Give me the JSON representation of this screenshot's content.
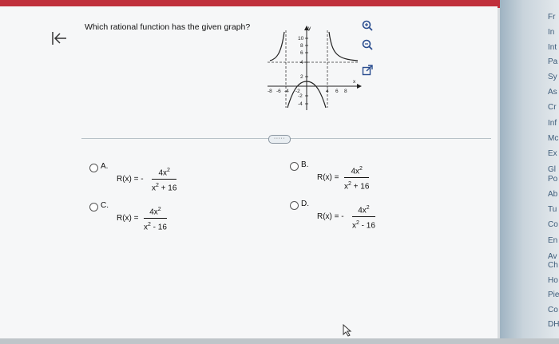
{
  "question": "Which rational function has the given graph?",
  "graph": {
    "y_axis_label": "y",
    "x_axis_label": "x",
    "y_ticks": [
      "10",
      "8",
      "6",
      "4",
      "2",
      "-2",
      "-4"
    ],
    "x_ticks_left": [
      "-8",
      "-6",
      "-4",
      "-2"
    ],
    "x_ticks_right": [
      "4",
      "6",
      "8"
    ]
  },
  "more_label": "·····",
  "options": [
    {
      "letter": "A.",
      "lhs": "R(x) = -",
      "num": "4x",
      "num_exp": "2",
      "den_base": "x",
      "den_exp": "2",
      "den_tail": " + 16"
    },
    {
      "letter": "B.",
      "lhs": "R(x) =",
      "num": "4x",
      "num_exp": "2",
      "den_base": "x",
      "den_exp": "2",
      "den_tail": " + 16"
    },
    {
      "letter": "C.",
      "lhs": "R(x) =",
      "num": "4x",
      "num_exp": "2",
      "den_base": "x",
      "den_exp": "2",
      "den_tail": " - 16"
    },
    {
      "letter": "D.",
      "lhs": "R(x) = -",
      "num": "4x",
      "num_exp": "2",
      "den_base": "x",
      "den_exp": "2",
      "den_tail": " - 16"
    }
  ],
  "right_panel_items": [
    "Fr",
    "In",
    "Int",
    "Pa",
    "Sy",
    "As",
    "Cr",
    "Inf",
    "Mc",
    "Ex",
    "Gl",
    "Po",
    "Ab",
    "Tu",
    "Co",
    "En",
    "Av",
    "Ch",
    "Ho",
    "Pie",
    "Co",
    "DH"
  ],
  "icons": {
    "back": "back-arrow-bar-icon",
    "zoom_in": "zoom-in-icon",
    "zoom_out": "zoom-out-icon",
    "popout": "external-link-icon"
  }
}
